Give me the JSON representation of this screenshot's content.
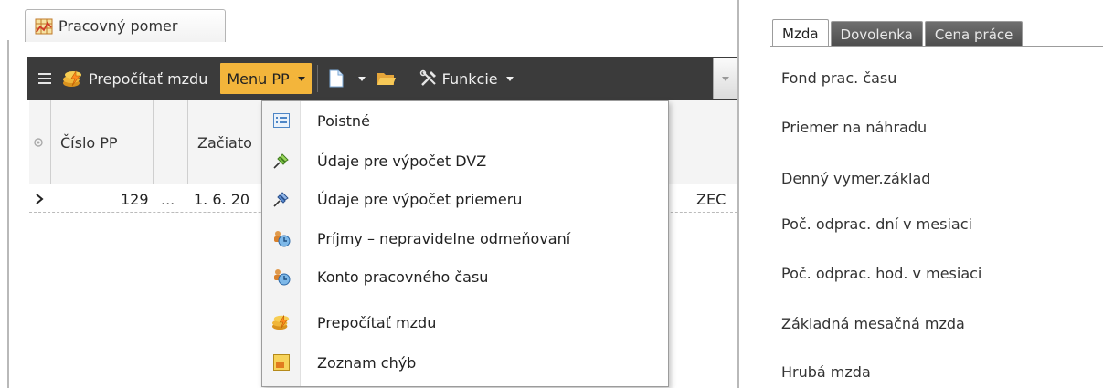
{
  "document_tab": {
    "title": "Pracovný pomer",
    "icon": "grid-map-icon"
  },
  "toolbar": {
    "menu_icon": "hamburger-icon",
    "recalc_label": "Prepočítať mzdu",
    "menu_pp_label": "Menu PP",
    "new_doc_icon": "new-document-icon",
    "open_folder_icon": "folder-open-icon",
    "functions_label": "Funkcie",
    "functions_icon": "tools-icon"
  },
  "grid": {
    "columns": [
      "",
      "Číslo PP",
      "",
      "Začiato"
    ],
    "row": {
      "cislo_pp": "129",
      "ellipsis": "...",
      "zaciatok": "1. 6. 20",
      "trailing": "ZEC"
    }
  },
  "dropdown": {
    "items": [
      {
        "label": "Poistné",
        "icon": "list-icon"
      },
      {
        "label": "Údaje pre výpočet DVZ",
        "icon": "pin-green-icon"
      },
      {
        "label": "Údaje pre výpočet priemeru",
        "icon": "pin-blue-icon"
      },
      {
        "label": "Príjmy – nepravidelne odmeňovaní",
        "icon": "users-clock-icon"
      },
      {
        "label": "Konto pracovného času",
        "icon": "users-clock-icon"
      },
      {
        "label": "Prepočítať mzdu",
        "icon": "coins-lightning-icon"
      },
      {
        "label": "Zoznam chýb",
        "icon": "error-list-icon"
      }
    ]
  },
  "right_panel": {
    "tabs": [
      {
        "label": "Mzda",
        "active": true
      },
      {
        "label": "Dovolenka",
        "active": false
      },
      {
        "label": "Cena práce",
        "active": false
      }
    ],
    "fields": [
      "Fond prac. času",
      "Priemer na náhradu",
      "Denný vymer.základ",
      "Poč. odprac. dní v mesiaci",
      "Poč. odprac. hod. v mesiaci",
      "Základná mesačná mzda",
      "Hrubá mzda"
    ]
  },
  "colors": {
    "toolbar_bg": "#3b3b3b",
    "menu_pp_highlight": "#f3b53b"
  }
}
